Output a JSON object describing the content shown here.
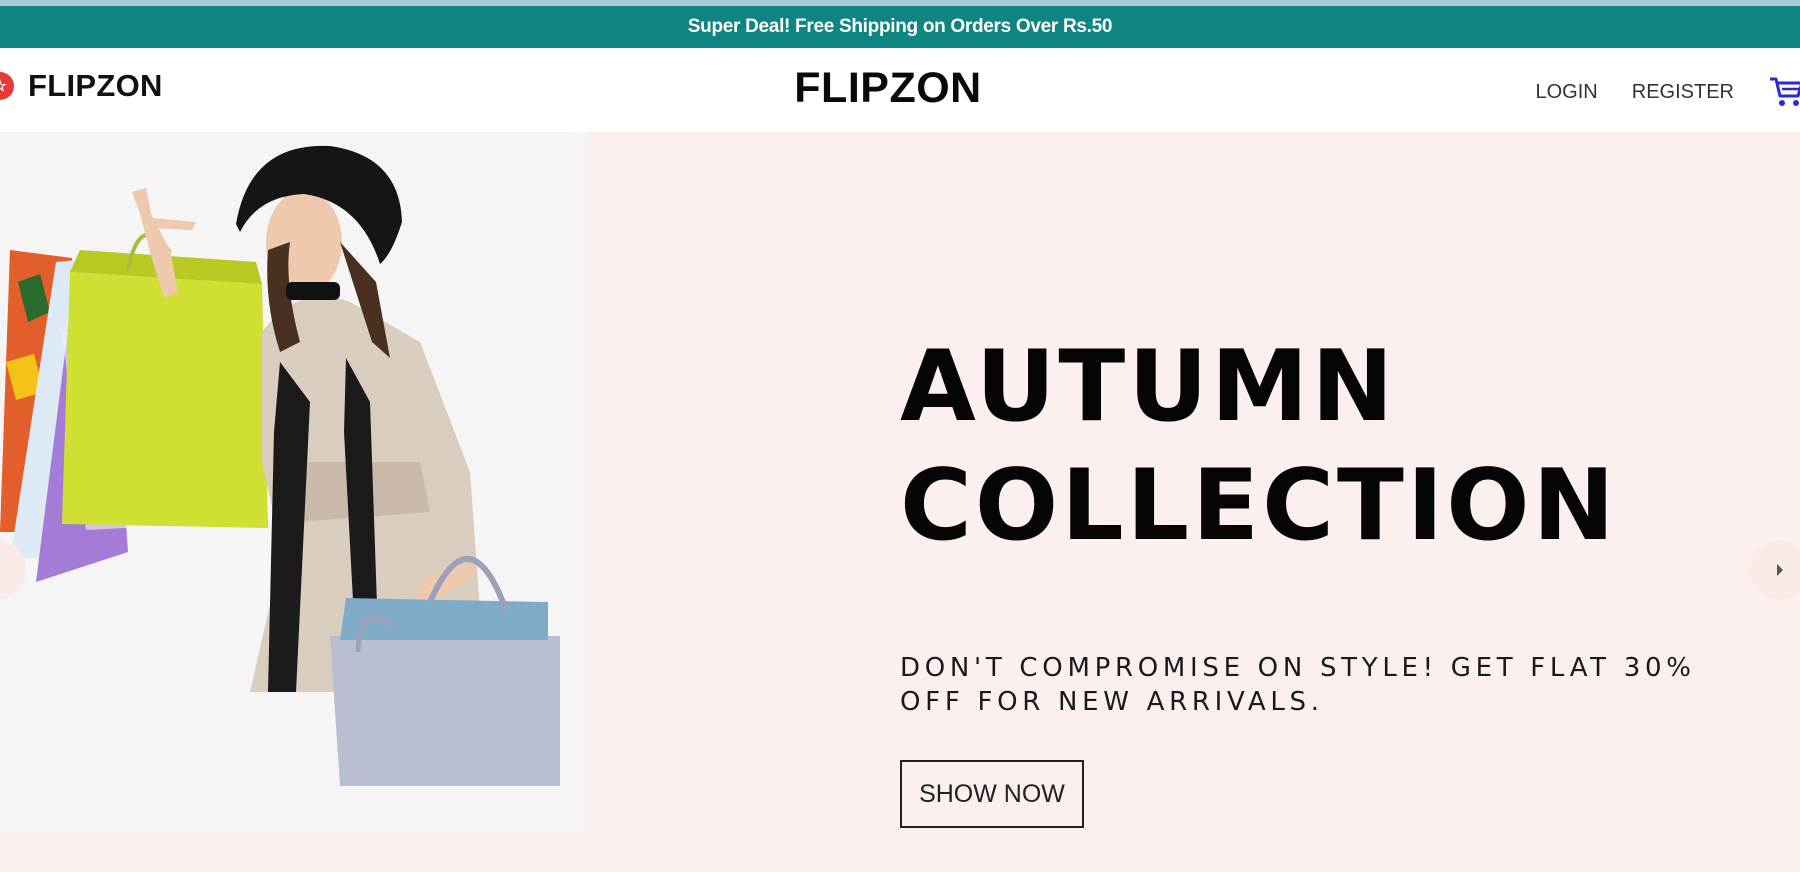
{
  "announcement": {
    "text": "Super Deal! Free Shipping on Orders Over Rs.50"
  },
  "header": {
    "logo_text": "FLIPZON",
    "brand_title": "FLIPZON",
    "links": {
      "login": "LOGIN",
      "register": "REGISTER"
    },
    "cart_icon": "cart-icon"
  },
  "hero": {
    "title_line1": "AUTUMN",
    "title_line2": "COLLECTION",
    "description": "DON'T COMPROMISE ON STYLE! GET FLAT 30% OFF FOR NEW ARRIVALS.",
    "button_label": "SHOW NOW",
    "image": "woman-with-shopping-bags"
  },
  "colors": {
    "announcement_bg": "#0e8580",
    "hero_bg": "#fbf0ee",
    "logo_badge": "#e63a36",
    "cart_icon": "#2a2ad6"
  }
}
